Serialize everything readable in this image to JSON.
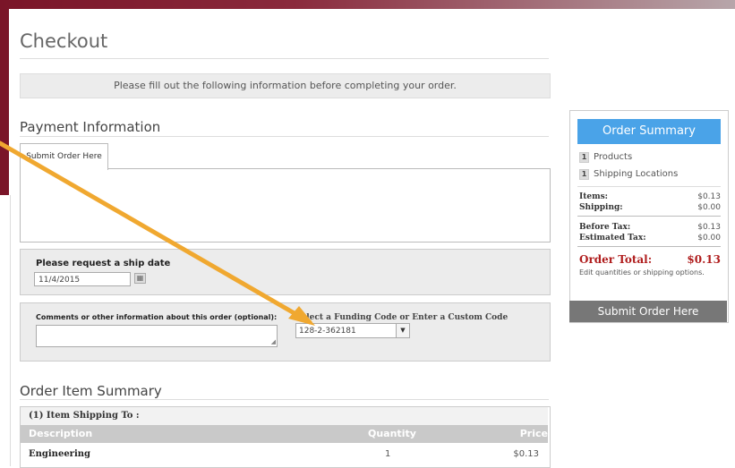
{
  "page": {
    "title": "Checkout",
    "notice": "Please fill out the following information before completing your order."
  },
  "payment": {
    "heading": "Payment Information",
    "tab_label": "Submit Order Here"
  },
  "ship_date": {
    "label": "Please request a ship date",
    "value": "11/4/2015"
  },
  "comments": {
    "label": "Comments or other information about this order (optional):"
  },
  "funding": {
    "label": "Select a Funding Code or Enter a Custom Code",
    "value": "128-2-362181"
  },
  "summary": {
    "header": "Order Summary",
    "products_count": "1",
    "products_label": "Products",
    "locations_count": "1",
    "locations_label": "Shipping Locations",
    "items_label": "Items:",
    "items_value": "$0.13",
    "shipping_label": "Shipping:",
    "shipping_value": "$0.00",
    "before_tax_label": "Before Tax:",
    "before_tax_value": "$0.13",
    "est_tax_label": "Estimated Tax:",
    "est_tax_value": "$0.00",
    "total_label": "Order Total:",
    "total_value": "$0.13",
    "edit_note": "Edit quantities or shipping options.",
    "submit_label": "Submit Order Here"
  },
  "order_items": {
    "heading": "Order Item Summary",
    "shipping_to": "(1) Item Shipping To :",
    "columns": [
      "Description",
      "Quantity",
      "Price"
    ],
    "rows": [
      {
        "description": "Engineering",
        "quantity": "1",
        "price": "$0.13"
      }
    ]
  },
  "colors": {
    "brand": "#7a1528",
    "accent": "#4aa3e8",
    "total": "#b01e1e",
    "annotation": "#f0a830"
  }
}
